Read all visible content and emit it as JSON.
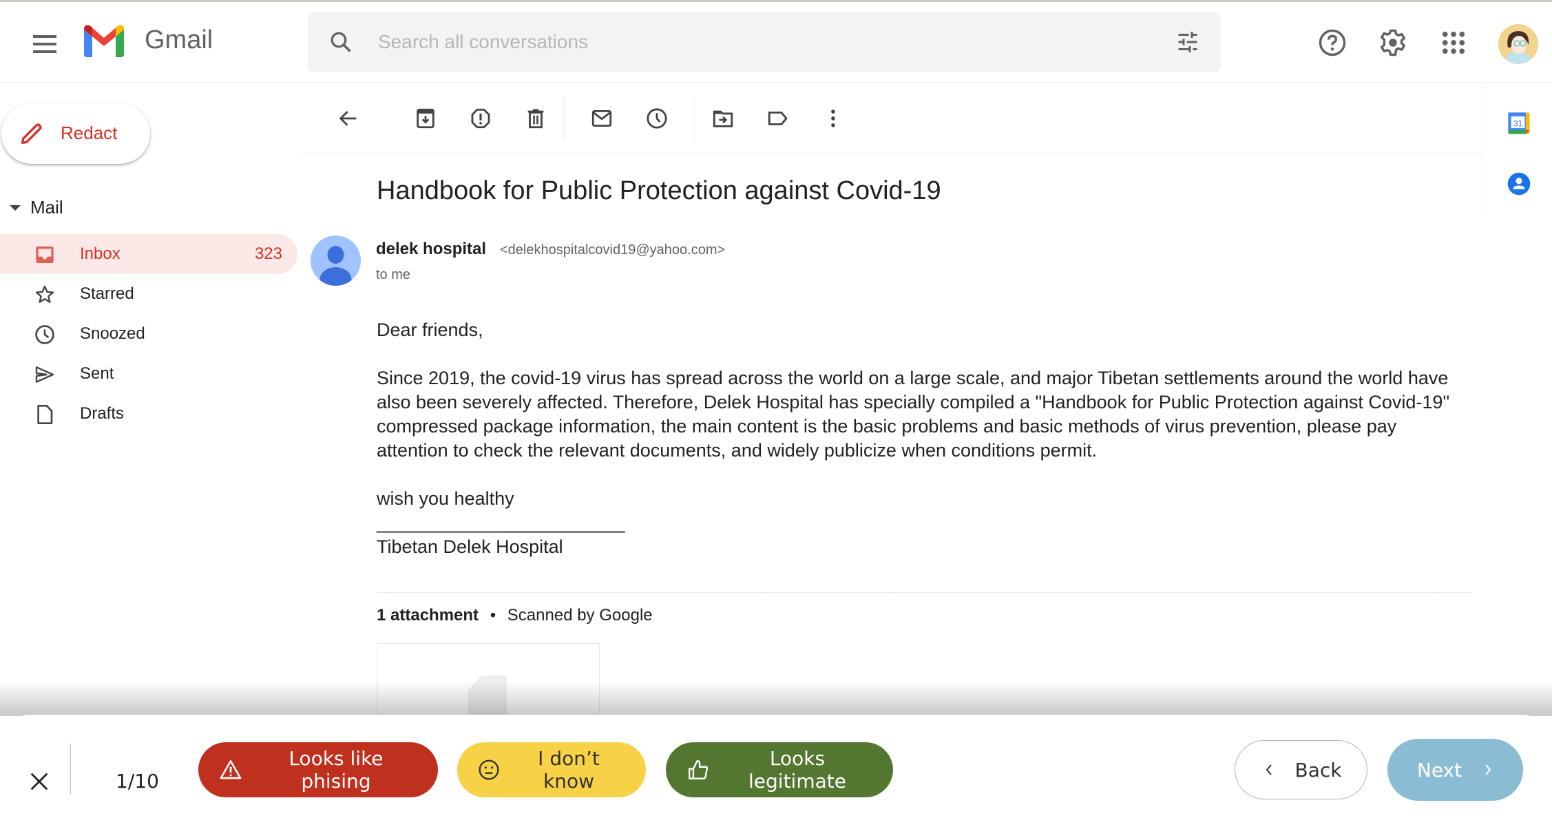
{
  "app": {
    "brand": "Gmail"
  },
  "header": {
    "menu_icon": "hamburger-menu-icon",
    "search_placeholder": "Search all conversations",
    "search_value": "",
    "icons": [
      "help-icon",
      "settings-gear-icon",
      "apps-grid-icon",
      "account-avatar"
    ]
  },
  "sidebar": {
    "compose_label": "Redact",
    "section_label": "Mail",
    "items": [
      {
        "label": "Inbox",
        "count": "323",
        "icon": "inbox-icon",
        "active": true
      },
      {
        "label": "Starred",
        "count": "",
        "icon": "star-icon",
        "active": false
      },
      {
        "label": "Snoozed",
        "count": "",
        "icon": "clock-icon",
        "active": false
      },
      {
        "label": "Sent",
        "count": "",
        "icon": "send-icon",
        "active": false
      },
      {
        "label": "Drafts",
        "count": "",
        "icon": "draft-icon",
        "active": false
      }
    ]
  },
  "toolbar": {
    "buttons": [
      "back-arrow",
      "archive",
      "report-spam",
      "delete",
      "mark-unread",
      "snooze",
      "move-to",
      "label",
      "more"
    ]
  },
  "side_panel": {
    "calendar_date": "31",
    "icons": [
      "calendar-icon",
      "contacts-icon"
    ]
  },
  "message": {
    "subject": "Handbook for Public Protection against Covid-19",
    "sender_name": "delek hospital",
    "sender_email": "<delekhospitalcovid19@yahoo.com>",
    "recipient": "to me",
    "greeting": "Dear friends,",
    "paragraph": "Since 2019, the covid-19 virus has spread across the world on a large scale, and major Tibetan settlements around the world have also been severely affected. Therefore, Delek Hospital has specially compiled a \"Handbook for Public Protection against Covid-19\" compressed package information, the main content is the basic problems and basic methods of virus prevention, please pay attention to check the relevant documents, and widely publicize when conditions permit.",
    "closing": "wish you healthy",
    "signature_line": "________________________",
    "signature": "Tibetan Delek Hospital",
    "attachment_count": "1 attachment",
    "attachment_separator": "•",
    "scan_note": "Scanned by Google"
  },
  "quiz_bar": {
    "progress": "1/10",
    "phishing_label": "Looks like phising",
    "unknown_label": "I don’t know",
    "legit_label": "Looks legitimate",
    "back_label": "Back",
    "next_label": "Next",
    "colors": {
      "phishing": "#c0301f",
      "unknown": "#f8d246",
      "legit": "#537730",
      "next": "#8abdd4"
    }
  }
}
